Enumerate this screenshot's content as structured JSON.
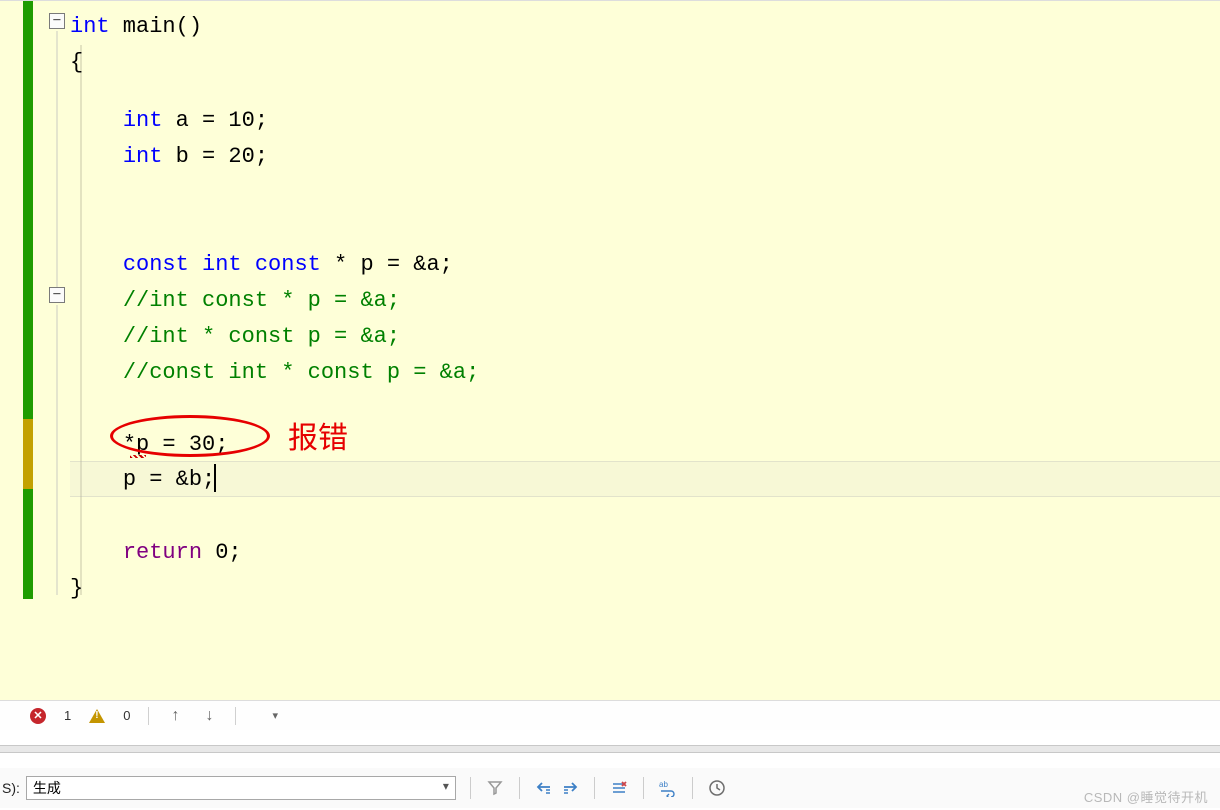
{
  "code": {
    "l0": "int main()",
    "l0_kw": "int",
    "l0_rest": " main()",
    "l1": "{",
    "l2_indent": "    ",
    "l2_kw": "int",
    "l2_rest": " a = 10;",
    "l3_indent": "    ",
    "l3_kw": "int",
    "l3_rest": " b = 20;",
    "l6_indent": "    ",
    "l6_kw1": "const",
    "l6_sp1": " ",
    "l6_kw2": "int",
    "l6_sp2": " ",
    "l6_kw3": "const",
    "l6_rest": " * p = &a;",
    "l7_indent": "    ",
    "l7": "//int const * p = &a;",
    "l8_indent": "    ",
    "l8": "//int * const p = &a;",
    "l9_indent": "    ",
    "l9": "//const int * const p = &a;",
    "l11_indent": "    ",
    "l11": "*p = 30;",
    "l12_indent": "    ",
    "l12": "p = &b;",
    "l14_indent": "    ",
    "l14_kw": "return",
    "l14_rest": " 0;",
    "l15": "}",
    "annotation": "报错"
  },
  "status": {
    "errors": "1",
    "warnings": "0"
  },
  "bottombar": {
    "label": "S):",
    "select_value": "生成"
  },
  "watermark": "CSDN @睡觉待开机"
}
